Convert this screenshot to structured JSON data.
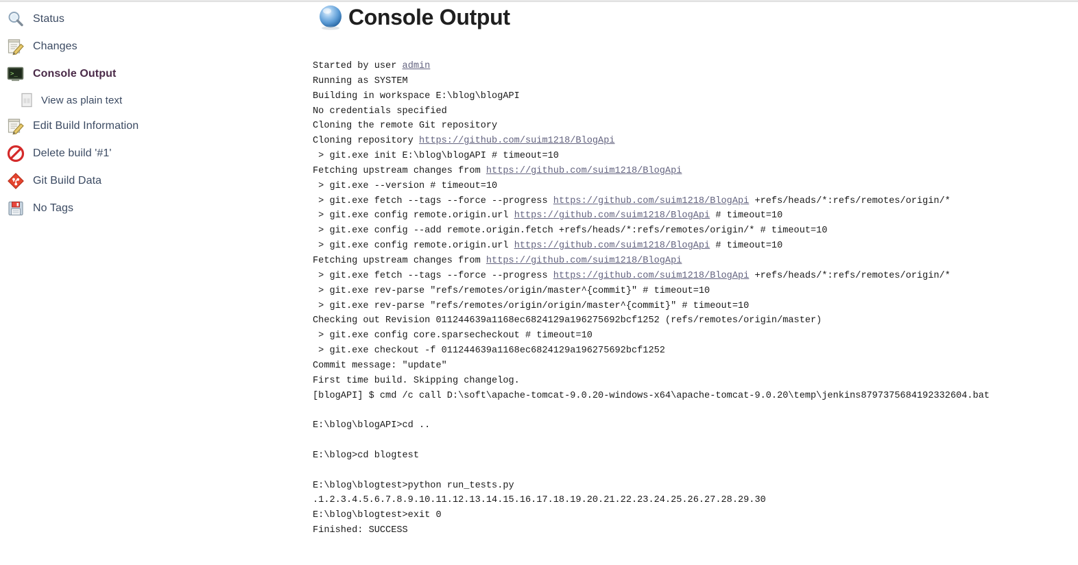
{
  "page": {
    "title": "Console Output",
    "title_icon": "blue-ball-icon"
  },
  "sidebar": {
    "items": [
      {
        "label": "Status",
        "icon": "magnifier-icon",
        "active": false,
        "sub": false
      },
      {
        "label": "Changes",
        "icon": "notepad-pencil-icon",
        "active": false,
        "sub": false
      },
      {
        "label": "Console Output",
        "icon": "terminal-icon",
        "active": true,
        "sub": false
      },
      {
        "label": "View as plain text",
        "icon": "document-icon",
        "active": false,
        "sub": true
      },
      {
        "label": "Edit Build Information",
        "icon": "notepad-pencil-icon",
        "active": false,
        "sub": false
      },
      {
        "label": "Delete build '#1'",
        "icon": "no-entry-icon",
        "active": false,
        "sub": false
      },
      {
        "label": "Git Build Data",
        "icon": "git-diamond-icon",
        "active": false,
        "sub": false
      },
      {
        "label": "No Tags",
        "icon": "floppy-disk-icon",
        "active": false,
        "sub": false
      }
    ]
  },
  "console": {
    "repo_url": "https://github.com/suim1218/BlogApi",
    "user_link": "admin",
    "lines": [
      {
        "type": "text",
        "parts": [
          {
            "t": "Started by user "
          },
          {
            "t": "admin",
            "link": true
          }
        ]
      },
      {
        "type": "text",
        "parts": [
          {
            "t": "Running as SYSTEM"
          }
        ]
      },
      {
        "type": "text",
        "parts": [
          {
            "t": "Building in workspace E:\\blog\\blogAPI"
          }
        ]
      },
      {
        "type": "text",
        "parts": [
          {
            "t": "No credentials specified"
          }
        ]
      },
      {
        "type": "text",
        "parts": [
          {
            "t": "Cloning the remote Git repository"
          }
        ]
      },
      {
        "type": "text",
        "parts": [
          {
            "t": "Cloning repository "
          },
          {
            "t": "https://github.com/suim1218/BlogApi",
            "link": true
          }
        ]
      },
      {
        "type": "text",
        "parts": [
          {
            "t": " > git.exe init E:\\blog\\blogAPI # timeout=10"
          }
        ]
      },
      {
        "type": "text",
        "parts": [
          {
            "t": "Fetching upstream changes from "
          },
          {
            "t": "https://github.com/suim1218/BlogApi",
            "link": true
          }
        ]
      },
      {
        "type": "text",
        "parts": [
          {
            "t": " > git.exe --version # timeout=10"
          }
        ]
      },
      {
        "type": "text",
        "parts": [
          {
            "t": " > git.exe fetch --tags --force --progress "
          },
          {
            "t": "https://github.com/suim1218/BlogApi",
            "link": true
          },
          {
            "t": " +refs/heads/*:refs/remotes/origin/*"
          }
        ]
      },
      {
        "type": "text",
        "parts": [
          {
            "t": " > git.exe config remote.origin.url "
          },
          {
            "t": "https://github.com/suim1218/BlogApi",
            "link": true
          },
          {
            "t": " # timeout=10"
          }
        ]
      },
      {
        "type": "text",
        "parts": [
          {
            "t": " > git.exe config --add remote.origin.fetch +refs/heads/*:refs/remotes/origin/* # timeout=10"
          }
        ]
      },
      {
        "type": "text",
        "parts": [
          {
            "t": " > git.exe config remote.origin.url "
          },
          {
            "t": "https://github.com/suim1218/BlogApi",
            "link": true
          },
          {
            "t": " # timeout=10"
          }
        ]
      },
      {
        "type": "text",
        "parts": [
          {
            "t": "Fetching upstream changes from "
          },
          {
            "t": "https://github.com/suim1218/BlogApi",
            "link": true
          }
        ]
      },
      {
        "type": "text",
        "parts": [
          {
            "t": " > git.exe fetch --tags --force --progress "
          },
          {
            "t": "https://github.com/suim1218/BlogApi",
            "link": true
          },
          {
            "t": " +refs/heads/*:refs/remotes/origin/*"
          }
        ]
      },
      {
        "type": "text",
        "parts": [
          {
            "t": " > git.exe rev-parse \"refs/remotes/origin/master^{commit}\" # timeout=10"
          }
        ]
      },
      {
        "type": "text",
        "parts": [
          {
            "t": " > git.exe rev-parse \"refs/remotes/origin/origin/master^{commit}\" # timeout=10"
          }
        ]
      },
      {
        "type": "text",
        "parts": [
          {
            "t": "Checking out Revision 011244639a1168ec6824129a196275692bcf1252 (refs/remotes/origin/master)"
          }
        ]
      },
      {
        "type": "text",
        "parts": [
          {
            "t": " > git.exe config core.sparsecheckout # timeout=10"
          }
        ]
      },
      {
        "type": "text",
        "parts": [
          {
            "t": " > git.exe checkout -f 011244639a1168ec6824129a196275692bcf1252"
          }
        ]
      },
      {
        "type": "text",
        "parts": [
          {
            "t": "Commit message: \"update\""
          }
        ]
      },
      {
        "type": "text",
        "parts": [
          {
            "t": "First time build. Skipping changelog."
          }
        ]
      },
      {
        "type": "text",
        "parts": [
          {
            "t": "[blogAPI] $ cmd /c call D:\\soft\\apache-tomcat-9.0.20-windows-x64\\apache-tomcat-9.0.20\\temp\\jenkins8797375684192332604.bat"
          }
        ]
      },
      {
        "type": "blank"
      },
      {
        "type": "text",
        "parts": [
          {
            "t": "E:\\blog\\blogAPI>cd .."
          }
        ]
      },
      {
        "type": "blank"
      },
      {
        "type": "text",
        "parts": [
          {
            "t": "E:\\blog>cd blogtest"
          }
        ]
      },
      {
        "type": "blank"
      },
      {
        "type": "text",
        "parts": [
          {
            "t": "E:\\blog\\blogtest>python run_tests.py"
          }
        ]
      },
      {
        "type": "text",
        "parts": [
          {
            "t": ".1.2.3.4.5.6.7.8.9.10.11.12.13.14.15.16.17.18.19.20.21.22.23.24.25.26.27.28.29.30"
          }
        ]
      },
      {
        "type": "text",
        "parts": [
          {
            "t": "E:\\blog\\blogtest>exit 0"
          }
        ]
      },
      {
        "type": "text",
        "parts": [
          {
            "t": "Finished: SUCCESS"
          }
        ]
      }
    ],
    "build_result": "SUCCESS",
    "test_count": 30,
    "exit_code": "0",
    "commit_hash": "011244639a1168ec6824129a196275692bcf1252",
    "commit_message": "update",
    "workspace": "E:\\blog\\blogAPI",
    "job_name": "blogAPI"
  },
  "colors": {
    "link": "#63637f",
    "sidebar_link": "#3b4a62",
    "sidebar_active": "#4a2a48",
    "console_text": "#1a1a1a"
  }
}
